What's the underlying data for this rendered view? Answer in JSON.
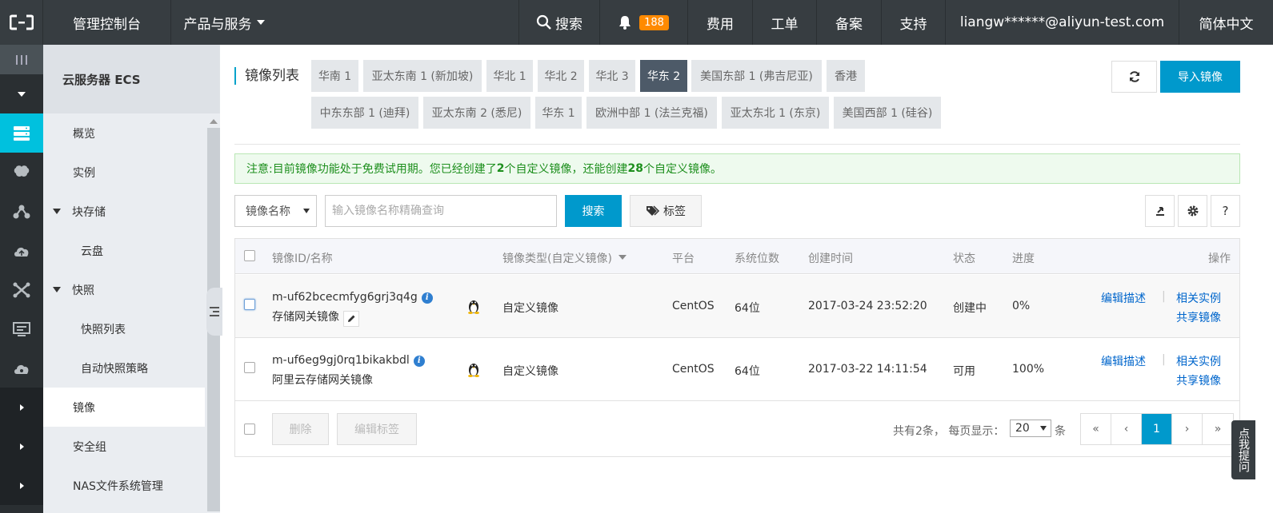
{
  "topbar": {
    "console_label": "管理控制台",
    "products_label": "产品与服务",
    "search_label": "搜索",
    "notifications_count": "188",
    "billing_label": "费用",
    "ticket_label": "工单",
    "icp_label": "备案",
    "support_label": "支持",
    "account": "liangw******@aliyun-test.com",
    "language": "简体中文"
  },
  "iconbar": {
    "icons": [
      "menu-toggle-icon",
      "expand-down-icon",
      "server-icon",
      "brain-icon",
      "network-icon",
      "cloud-upload-icon",
      "cross-arrows-icon",
      "list-screen-icon",
      "cloud-icon",
      "chevron-right-icon",
      "chevron-right-icon",
      "chevron-right-icon"
    ]
  },
  "sidebar": {
    "title": "云服务器 ECS",
    "items": [
      {
        "label": "概览"
      },
      {
        "label": "实例"
      },
      {
        "label": "块存储"
      },
      {
        "label": "云盘"
      },
      {
        "label": "快照"
      },
      {
        "label": "快照列表"
      },
      {
        "label": "自动快照策略"
      },
      {
        "label": "镜像"
      },
      {
        "label": "安全组"
      },
      {
        "label": "NAS文件系统管理"
      }
    ]
  },
  "main": {
    "title": "镜像列表",
    "regions": [
      "华南 1",
      "亚太东南 1 (新加坡)",
      "华北 1",
      "华北 2",
      "华北 3",
      "华东 2",
      "美国东部 1 (弗吉尼亚)",
      "香港",
      "中东东部 1 (迪拜)",
      "亚太东南 2 (悉尼)",
      "华东 1",
      "欧洲中部 1 (法兰克福)",
      "亚太东北 1 (东京)",
      "美国西部 1 (硅谷)"
    ],
    "selected_region": "华东 2",
    "import_button": "导入镜像",
    "notice_prefix": "注意:目前镜像功能处于免费试用期。您已经创建了",
    "notice_created": "2",
    "notice_mid": "个自定义镜像，还能创建",
    "notice_remaining": "28",
    "notice_suffix": "个自定义镜像。",
    "filter_select": "镜像名称",
    "search_placeholder": "输入镜像名称精确查询",
    "search_button": "搜索",
    "tag_button": "标签",
    "help_button": "?"
  },
  "table": {
    "headers": {
      "id_name": "镜像ID/名称",
      "type": "镜像类型(自定义镜像)",
      "platform": "平台",
      "bits": "系统位数",
      "created": "创建时间",
      "status": "状态",
      "progress": "进度",
      "actions": "操作"
    },
    "rows": [
      {
        "id": "m-uf62bcecmfyg6grj3q4g",
        "name": "存储网关镜像",
        "type": "自定义镜像",
        "platform": "CentOS",
        "bits": "64位",
        "created": "2017-03-24 23:52:20",
        "status": "创建中",
        "progress": "0%",
        "action_edit": "编辑描述",
        "action_instances": "相关实例",
        "action_share": "共享镜像"
      },
      {
        "id": "m-uf6eg9gj0rq1bikakbdl",
        "name": "阿里云存储网关镜像",
        "type": "自定义镜像",
        "platform": "CentOS",
        "bits": "64位",
        "created": "2017-03-22 14:11:54",
        "status": "可用",
        "progress": "100%",
        "action_edit": "编辑描述",
        "action_instances": "相关实例",
        "action_share": "共享镜像"
      }
    ],
    "delete_button": "删除",
    "edit_tags_button": "编辑标签",
    "page_info": "共有2条， 每页显示：",
    "page_size": "20",
    "page_unit": "条",
    "pager": {
      "first": "«",
      "prev": "‹",
      "current": "1",
      "next": "›",
      "last": "»"
    }
  },
  "help_float": "点我提问",
  "colors": {
    "topbar": "#373d41",
    "accent": "#0099cc",
    "active_icon": "#00c1de",
    "selected_region": "#4d5a68",
    "badge": "#ff8a00",
    "link": "#0066cc"
  }
}
